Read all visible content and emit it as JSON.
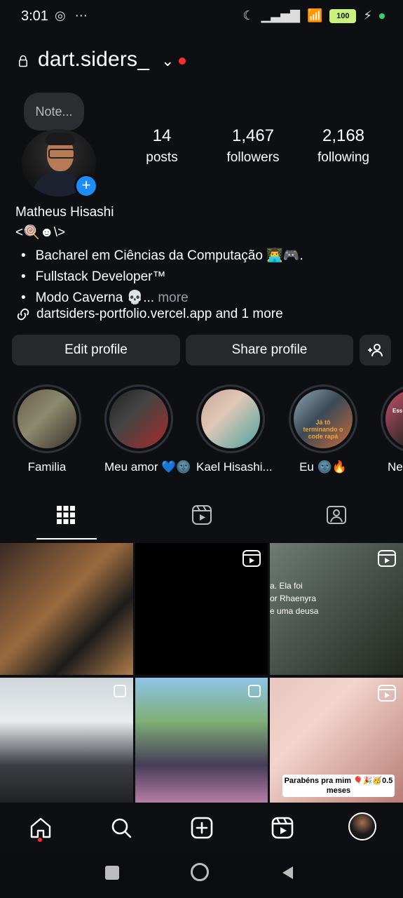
{
  "status_bar": {
    "time": "3:01",
    "left_icons": [
      "instagram-icon",
      "more-dots-icon"
    ],
    "right_icons": [
      "moon-icon",
      "signal-icon",
      "wifi-icon",
      "battery-icon",
      "charging-icon",
      "dot-icon"
    ],
    "battery": "100"
  },
  "profile": {
    "username": "dart.siders_",
    "note_placeholder": "Note...",
    "stats": [
      {
        "value": "14",
        "label": "posts"
      },
      {
        "value": "1,467",
        "label": "followers"
      },
      {
        "value": "2,168",
        "label": "following"
      }
    ],
    "full_name": "Matheus Hisashi",
    "pronoun": "<🍭☻\\>",
    "bio_lines": [
      "Bacharel em Ciências da Computação 👨‍💻🎮.",
      "Fullstack Developer™",
      "Modo Caverna 💀..."
    ],
    "bio_more": "more",
    "link": "dartsiders-portfolio.vercel.app and 1 more"
  },
  "actions": {
    "edit_profile": "Edit profile",
    "share_profile": "Share profile"
  },
  "highlights": [
    {
      "label": "Familia"
    },
    {
      "label": "Meu amor 💙🌚"
    },
    {
      "label": "Kael Hisashi..."
    },
    {
      "label": "Eu 🌚🔥",
      "overlay": "Já tô terminando o code rapá"
    },
    {
      "label": "Ne",
      "overlay": "Ess"
    }
  ],
  "tabs": [
    "grid-icon",
    "reels-icon",
    "tagged-icon"
  ],
  "grid_posts": [
    {
      "kind": "photo",
      "overlay_text": ""
    },
    {
      "kind": "reel",
      "overlay_text": ""
    },
    {
      "kind": "reel",
      "overlay_text": "a. Ela foi\nor Rhaenyra\ne uma deusa"
    },
    {
      "kind": "multi",
      "overlay_text": ""
    },
    {
      "kind": "multi",
      "overlay_text": ""
    },
    {
      "kind": "reel",
      "overlay_text": "Parabéns pra mim 🎈🎉🥳0.5 meses"
    }
  ],
  "bottom_nav": [
    "home-icon",
    "search-icon",
    "create-icon",
    "reels-icon",
    "profile-avatar"
  ],
  "system_nav": [
    "square-icon",
    "circle-icon",
    "back-icon"
  ]
}
